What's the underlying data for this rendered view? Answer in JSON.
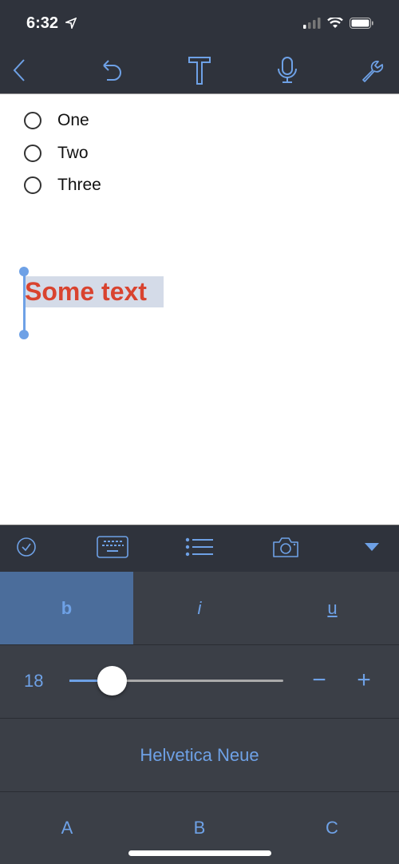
{
  "status_bar": {
    "time": "6:32",
    "icons": [
      "location-arrow-icon",
      "signal-icon",
      "wifi-icon",
      "battery-icon"
    ]
  },
  "nav": {
    "icons": [
      "back-chevron-icon",
      "undo-icon",
      "text-format-icon",
      "microphone-icon",
      "wrench-icon"
    ]
  },
  "editor": {
    "todos": [
      {
        "label": "One",
        "checked": false
      },
      {
        "label": "Two",
        "checked": false
      },
      {
        "label": "Three",
        "checked": false
      }
    ],
    "selected_text": "Some text",
    "selected_text_color": "#d9432f",
    "selection_color": "#d4dbe8"
  },
  "toolbar": {
    "icons": [
      "checkmark-circle-icon",
      "keyboard-icon",
      "bullet-list-icon",
      "camera-icon",
      "collapse-triangle-icon"
    ]
  },
  "format": {
    "bold_label": "b",
    "italic_label": "i",
    "underline_label": "u",
    "active": "bold"
  },
  "font_size": {
    "value": "18",
    "slider_fraction": 0.2,
    "minus_label": "−",
    "plus_label": "+"
  },
  "font": {
    "name": "Helvetica Neue"
  },
  "styles": [
    "A",
    "B",
    "C"
  ],
  "colors": {
    "accent": "#6ea1e6",
    "bar_bg": "#2f333c",
    "panel_bg": "#3b3f47",
    "active_bg": "#4b6d9b"
  }
}
